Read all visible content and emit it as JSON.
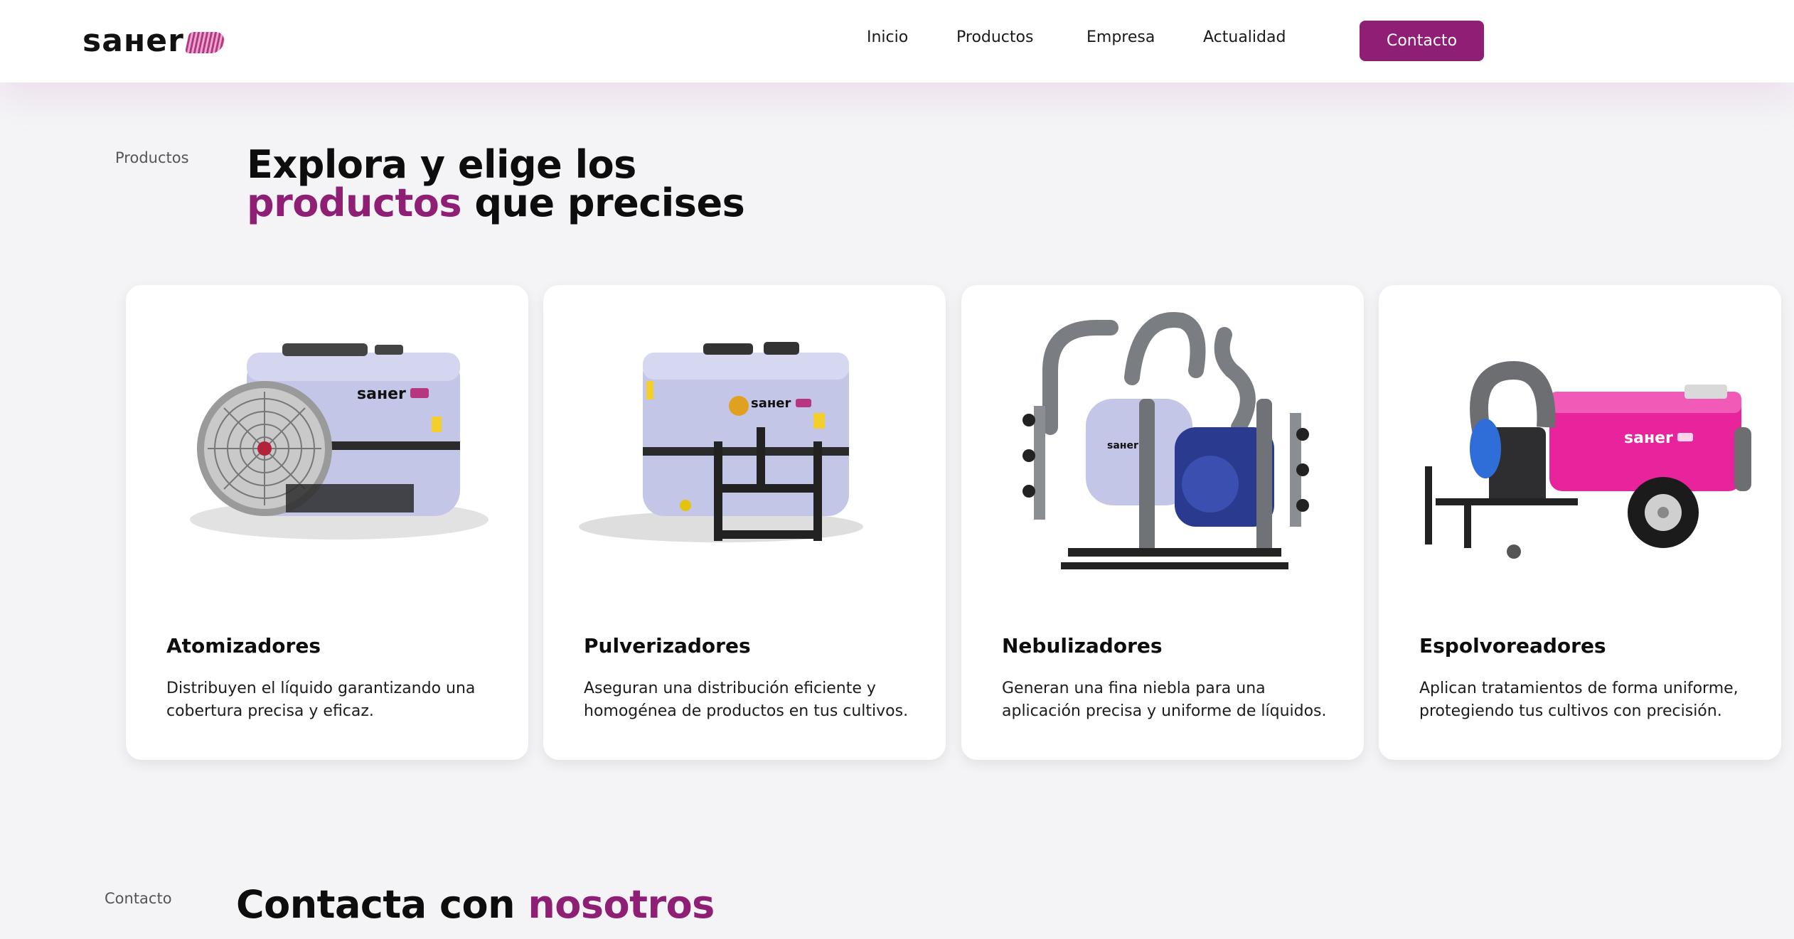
{
  "header": {
    "logo_text": "saнer",
    "nav": [
      {
        "label": "Inicio"
      },
      {
        "label": "Productos"
      },
      {
        "label": "Empresa"
      },
      {
        "label": "Actualidad"
      }
    ],
    "contact_button": "Contacto"
  },
  "products_section": {
    "label": "Productos",
    "heading_line1": "Explora y elige los",
    "heading_accent": "productos",
    "heading_rest": " que precises"
  },
  "cards": [
    {
      "title": "Atomizadores",
      "description": "Distribuyen el líquido garantizando una cobertura precisa y eficaz.",
      "image": "atomizer-image",
      "brand": "saнer"
    },
    {
      "title": "Pulverizadores",
      "description": "Aseguran una distribución eficiente y homogénea de productos en tus cultivos.",
      "image": "sprayer-image",
      "brand": "saнer"
    },
    {
      "title": "Nebulizadores",
      "description": "Generan una fina niebla para una aplicación precisa y uniforme de líquidos.",
      "image": "nebulizer-image",
      "brand": "saнer"
    },
    {
      "title": "Espolvoreadores",
      "description": "Aplican tratamientos de forma uniforme, protegiendo tus cultivos con precisión.",
      "image": "duster-image",
      "brand": "saнer"
    }
  ],
  "contact_section": {
    "label": "Contacto",
    "heading_plain": "Contacta con ",
    "heading_accent": "nosotros"
  },
  "colors": {
    "accent": "#8e1f75",
    "background": "#f4f4f6",
    "card": "#ffffff"
  }
}
